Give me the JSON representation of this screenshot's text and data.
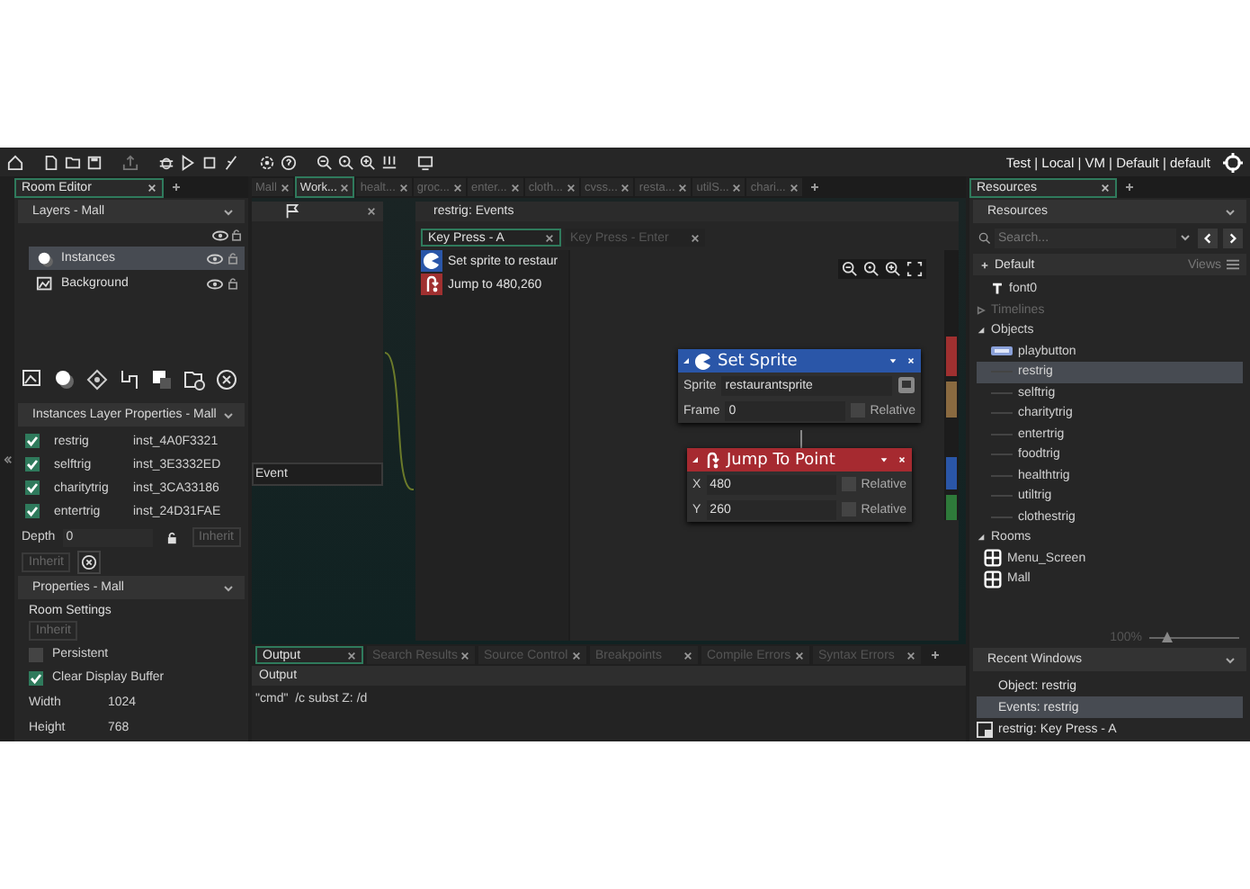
{
  "toolbar": {
    "target": "Test | Local | VM | Default | default"
  },
  "room_editor": {
    "tab": "Room Editor",
    "layers": {
      "title": "Layers - Mall",
      "items": [
        {
          "name": "Instances",
          "kind": "instance",
          "selected": true
        },
        {
          "name": "Background",
          "kind": "background",
          "selected": false
        }
      ]
    },
    "instances": {
      "title": "Instances Layer Properties - Mall",
      "rows": [
        {
          "object": "restrig",
          "id": "inst_4A0F3321",
          "checked": true
        },
        {
          "object": "selftrig",
          "id": "inst_3E3332ED",
          "checked": true
        },
        {
          "object": "charitytrig",
          "id": "inst_3CA33186",
          "checked": true
        },
        {
          "object": "entertrig",
          "id": "inst_24D31FAE",
          "checked": true
        }
      ]
    },
    "depth": {
      "label": "Depth",
      "value": "0",
      "inherit": "Inherit"
    },
    "inherit": "Inherit",
    "properties": {
      "title": "Properties - Mall",
      "section": "Room Settings",
      "inherit": "Inherit",
      "options": [
        {
          "label": "Persistent",
          "checked": false
        },
        {
          "label": "Clear Display Buffer",
          "checked": true
        }
      ],
      "fields": [
        {
          "label": "Width",
          "value": "1024"
        },
        {
          "label": "Height",
          "value": "768"
        }
      ]
    }
  },
  "editor_tabs": [
    {
      "label": "Mall",
      "selected": false
    },
    {
      "label": "Work...",
      "selected": true
    },
    {
      "label": "healt...",
      "selected": false
    },
    {
      "label": "groc...",
      "selected": false
    },
    {
      "label": "enter...",
      "selected": false
    },
    {
      "label": "cloth...",
      "selected": false
    },
    {
      "label": "cvss...",
      "selected": false
    },
    {
      "label": "resta...",
      "selected": false
    },
    {
      "label": "utilS...",
      "selected": false
    },
    {
      "label": "chari...",
      "selected": false
    }
  ],
  "workspace": {
    "event_field": "Event"
  },
  "events_window": {
    "title": "restrig: Events",
    "tabs": [
      {
        "label": "Key Press - A",
        "selected": true
      },
      {
        "label": "Key Press - Enter",
        "selected": false
      }
    ],
    "actions": [
      {
        "label": "Set sprite to restaur",
        "kind": "sprite"
      },
      {
        "label": "Jump to 480,260",
        "kind": "jump"
      }
    ],
    "nodes": [
      {
        "kind": "sprite",
        "title": "Set Sprite",
        "fields": [
          {
            "label": "Sprite",
            "value": "restaurantsprite",
            "kind": "picker"
          },
          {
            "label": "Frame",
            "value": "0",
            "kind": "relative",
            "relative_label": "Relative",
            "checked": false
          }
        ]
      },
      {
        "kind": "jump",
        "title": "Jump To Point",
        "fields": [
          {
            "label": "X",
            "value": "480",
            "kind": "relative",
            "relative_label": "Relative",
            "checked": false
          },
          {
            "label": "Y",
            "value": "260",
            "kind": "relative",
            "relative_label": "Relative",
            "checked": false
          }
        ]
      }
    ]
  },
  "output": {
    "tabs": [
      {
        "label": "Output",
        "selected": true
      },
      {
        "label": "Search Results",
        "selected": false
      },
      {
        "label": "Source Control",
        "selected": false
      },
      {
        "label": "Breakpoints",
        "selected": false
      },
      {
        "label": "Compile Errors",
        "selected": false
      },
      {
        "label": "Syntax Errors",
        "selected": false
      }
    ],
    "header": "Output",
    "lines": [
      "\"cmd\"  /c subst Z: /d"
    ]
  },
  "resources": {
    "tab": "Resources",
    "header": "Resources",
    "placeholder": "Search...",
    "group": "Default",
    "views": "Views",
    "tree": [
      {
        "label": "font0",
        "kind": "font"
      },
      {
        "label": "Timelines",
        "kind": "folder",
        "expanded": false,
        "empty": true
      },
      {
        "label": "Objects",
        "kind": "folder",
        "expanded": true,
        "empty": false,
        "children": [
          {
            "label": "playbutton",
            "kind": "sprite-object",
            "selected": false
          },
          {
            "label": "restrig",
            "kind": "object",
            "selected": true
          },
          {
            "label": "selftrig",
            "kind": "object",
            "selected": false
          },
          {
            "label": "charitytrig",
            "kind": "object",
            "selected": false
          },
          {
            "label": "entertrig",
            "kind": "object",
            "selected": false
          },
          {
            "label": "foodtrig",
            "kind": "object",
            "selected": false
          },
          {
            "label": "healthtrig",
            "kind": "object",
            "selected": false
          },
          {
            "label": "utiltrig",
            "kind": "object",
            "selected": false
          },
          {
            "label": "clothestrig",
            "kind": "object",
            "selected": false
          }
        ]
      },
      {
        "label": "Rooms",
        "kind": "folder",
        "expanded": true,
        "empty": false,
        "children": [
          {
            "label": "Menu_Screen",
            "kind": "room",
            "selected": false
          },
          {
            "label": "Mall",
            "kind": "room",
            "selected": false
          }
        ]
      }
    ],
    "zoom": "100%",
    "zoom_slider": {
      "level": 0.2
    }
  },
  "recent_windows": {
    "title": "Recent Windows",
    "items": [
      {
        "label": "Object: restrig",
        "kind": "text",
        "selected": false
      },
      {
        "label": "Events: restrig",
        "kind": "text",
        "selected": true
      },
      {
        "label": "restrig: Key Press - A",
        "kind": "window",
        "selected": false
      }
    ]
  }
}
